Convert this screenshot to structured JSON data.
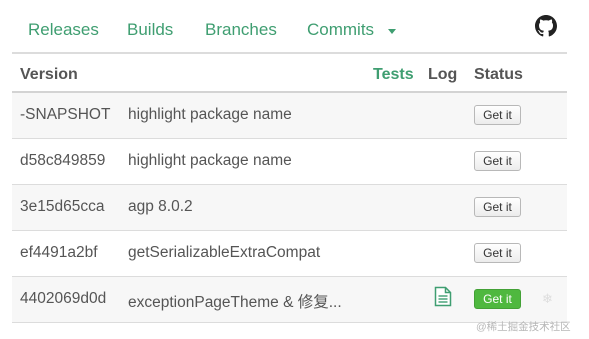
{
  "nav": {
    "releases": "Releases",
    "builds": "Builds",
    "branches": "Branches",
    "commits": "Commits"
  },
  "table": {
    "headers": {
      "version": "Version",
      "tests": "Tests",
      "log": "Log",
      "status": "Status"
    },
    "rows": [
      {
        "version": "-SNAPSHOT",
        "message": "highlight package name",
        "action": "Get it"
      },
      {
        "version": "d58c849859",
        "message": "highlight package name",
        "action": "Get it"
      },
      {
        "version": "3e15d65cca",
        "message": "agp 8.0.2",
        "action": "Get it"
      },
      {
        "version": "ef4491a2bf",
        "message": "getSerializableExtraCompat",
        "action": "Get it"
      },
      {
        "version": "4402069d0d",
        "message": "exceptionPageTheme & 修复...",
        "action": "Get it"
      }
    ]
  },
  "watermark": "@稀土掘金技术社区",
  "colors": {
    "accent": "#3f9e71",
    "success_button": "#4fb83f"
  },
  "icons": [
    "github-icon",
    "chevron-down-icon",
    "document-icon",
    "snowflake-icon"
  ]
}
